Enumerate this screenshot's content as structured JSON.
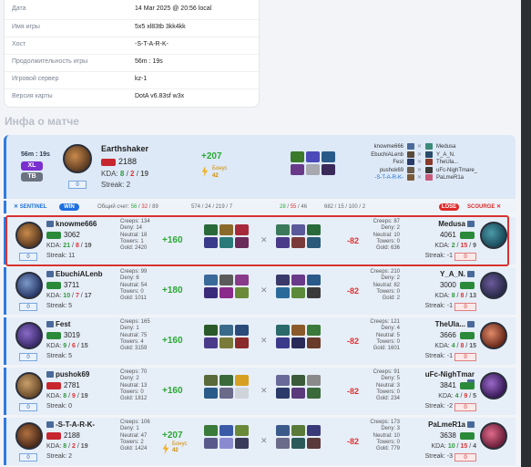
{
  "info": [
    {
      "k": "Дата",
      "v": "14 Mar 2025 @ 20:56 local"
    },
    {
      "k": "Имя игры",
      "v": "5x5 xl83tb 3kk4kk"
    },
    {
      "k": "Хост",
      "v": "-S-T-A-R-K-"
    },
    {
      "k": "Продолжительность игры",
      "v": "56m : 19s"
    },
    {
      "k": "Игровой сервер",
      "v": "kz-1"
    },
    {
      "k": "Версия карты",
      "v": "DotA v6.83sf w3x"
    }
  ],
  "section_title": "Инфа о матче",
  "summary": {
    "duration": "56m : 19s",
    "mode1": "XL",
    "mode2": "TB",
    "hero": "Earthshaker",
    "mmr": "2188",
    "kda_label": "KDA:",
    "k": "8",
    "d": "2",
    "a": "19",
    "streak": "Streak: 2",
    "level": "0",
    "plus": "+207",
    "bonus_label": "Бонус",
    "bonus": "42"
  },
  "players_list": [
    {
      "l": "knowme666",
      "r": "Medusa"
    },
    {
      "l": "EbuchiALenb",
      "r": "Y_A_N."
    },
    {
      "l": "Fest",
      "r": "TheUla..."
    },
    {
      "l": "pushok69",
      "r": "uFc-NighTmare_"
    },
    {
      "l": "-S-T-A-R-K-",
      "r": "PaLmeR1a"
    }
  ],
  "teambar": {
    "sentinel": "✕ SENTINEL",
    "win": "WIN",
    "score_label": "Общий счет:",
    "s1": "56",
    "s2": "32",
    "s3": "89",
    "mid1": "574 / 24 / 219 / 7",
    "s4": "28",
    "s5": "55",
    "s6": "46",
    "mid2": "682 / 15 / 100 / 2",
    "lose": "LOSE",
    "scourge": "SCOURGE ✕"
  },
  "rows": [
    {
      "name": "knowme666",
      "mmr": "3062",
      "k": "21",
      "d": "8",
      "a": "19",
      "streak": "Streak: 11",
      "lvl": "0",
      "stats": [
        "Creeps: 134",
        "Deny: 14",
        "Neutral: 18",
        "Towers: 1",
        "Gold: 2420"
      ],
      "plus": "+160",
      "rstats": [
        "Creeps: 87",
        "Deny: 2",
        "Neutral: 10",
        "Towers: 0",
        "Gold: 636"
      ],
      "minus": "-82",
      "rname": "Medusa",
      "rmmr": "4061",
      "rk": "2",
      "rd": "15",
      "ra": "9",
      "rstreak": "Streak: -1",
      "rlvl": "0"
    },
    {
      "name": "EbuchiALenb",
      "mmr": "3711",
      "k": "10",
      "d": "7",
      "a": "17",
      "streak": "Streak: 5",
      "lvl": "0",
      "stats": [
        "Creeps: 99",
        "Deny: 6",
        "Neutral: 54",
        "Towers: 0",
        "Gold: 1011"
      ],
      "plus": "+180",
      "rstats": [
        "Creeps: 210",
        "Deny: 2",
        "Neutral: 82",
        "Towers: 0",
        "Gold: 2"
      ],
      "minus": "-82",
      "rname": "Y_A_N.",
      "rmmr": "3000",
      "rk": "8",
      "rd": "8",
      "ra": "13",
      "rstreak": "Streak: -1",
      "rlvl": "0"
    },
    {
      "name": "Fest",
      "mmr": "3019",
      "k": "9",
      "d": "6",
      "a": "15",
      "streak": "Streak: 5",
      "lvl": "0",
      "stats": [
        "Creeps: 165",
        "Deny: 1",
        "Neutral: 75",
        "Towers: 4",
        "Gold: 3159"
      ],
      "plus": "+160",
      "rstats": [
        "Creeps: 121",
        "Deny: 4",
        "Neutral: 5",
        "Towers: 0",
        "Gold: 1601"
      ],
      "minus": "-82",
      "rname": "TheUla...",
      "rmmr": "3666",
      "rk": "4",
      "rd": "8",
      "ra": "15",
      "rstreak": "Streak: -1",
      "rlvl": "0"
    },
    {
      "name": "pushok69",
      "mmr": "2781",
      "k": "8",
      "d": "9",
      "a": "19",
      "streak": "Streak: 0",
      "lvl": "0",
      "stats": [
        "Creeps: 70",
        "Deny: 2",
        "Neutral: 13",
        "Towers: 0",
        "Gold: 1812"
      ],
      "plus": "+160",
      "rstats": [
        "Creeps: 91",
        "Deny: 5",
        "Neutral: 3",
        "Towers: 0",
        "Gold: 234"
      ],
      "minus": "-82",
      "rname": "uFc-NighTmar",
      "rmmr": "3841",
      "rk": "4",
      "rd": "9",
      "ra": "5",
      "rstreak": "Streak: -2",
      "rlvl": "0"
    },
    {
      "name": "-S-T-A-R-K-",
      "mmr": "2188",
      "k": "8",
      "d": "2",
      "a": "19",
      "streak": "Streak: 2",
      "lvl": "0",
      "stats": [
        "Creeps: 106",
        "Deny: 1",
        "Neutral: 47",
        "Towers: 2",
        "Gold: 1424"
      ],
      "plus": "+207",
      "bonus": "42",
      "rstats": [
        "Creeps: 173",
        "Deny: 3",
        "Neutral: 10",
        "Towers: 0",
        "Gold: 779"
      ],
      "minus": "-82",
      "rname": "PaLmeR1a",
      "rmmr": "3638",
      "rk": "10",
      "rd": "15",
      "ra": "4",
      "rstreak": "Streak: -3",
      "rlvl": "0"
    }
  ]
}
